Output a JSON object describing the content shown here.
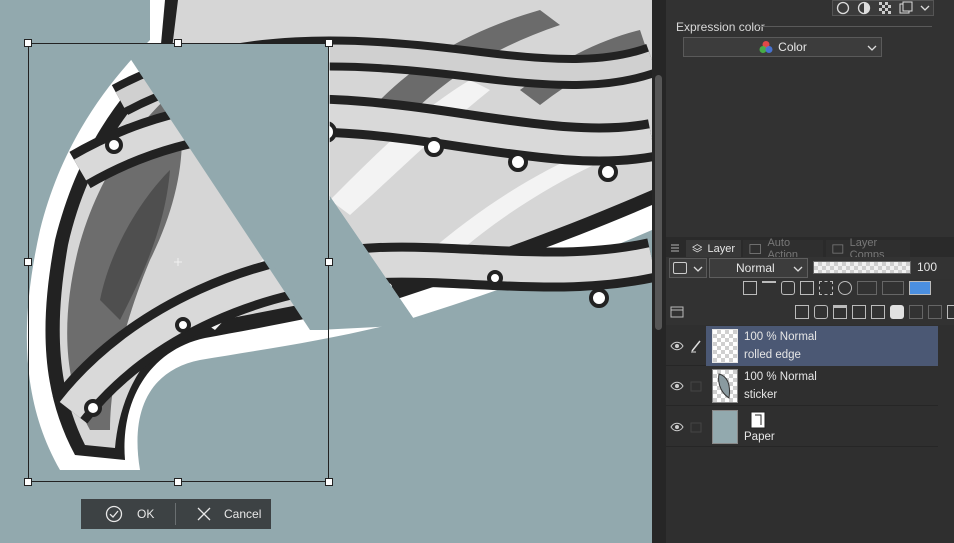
{
  "canvas": {
    "background": "#92a9ae",
    "confirm": {
      "ok_label": "OK",
      "cancel_label": "Cancel"
    }
  },
  "panel": {
    "top_icons": [
      "circle-icon",
      "half-circle-icon",
      "checker-icon",
      "layers-small-icon",
      "chevron-down-icon"
    ],
    "expression_color": {
      "label": "Expression color",
      "value": "Color"
    },
    "tabs": [
      {
        "label": "Layer",
        "active": true
      },
      {
        "label": "Auto Action",
        "active": false
      },
      {
        "label": "Layer Comps",
        "active": false
      }
    ],
    "blend_mode": "Normal",
    "opacity": "100",
    "layers": [
      {
        "mode": "100 % Normal",
        "name": "rolled edge",
        "selected": true,
        "thumb": "checker"
      },
      {
        "mode": "100 % Normal",
        "name": "sticker",
        "selected": false,
        "thumb": "sticker"
      },
      {
        "mode": "",
        "name": "Paper",
        "selected": false,
        "thumb": "paper"
      }
    ]
  },
  "colors": {
    "accent_selected": "#4b5874",
    "paper": "#92a9ae",
    "panel": "#323232"
  }
}
